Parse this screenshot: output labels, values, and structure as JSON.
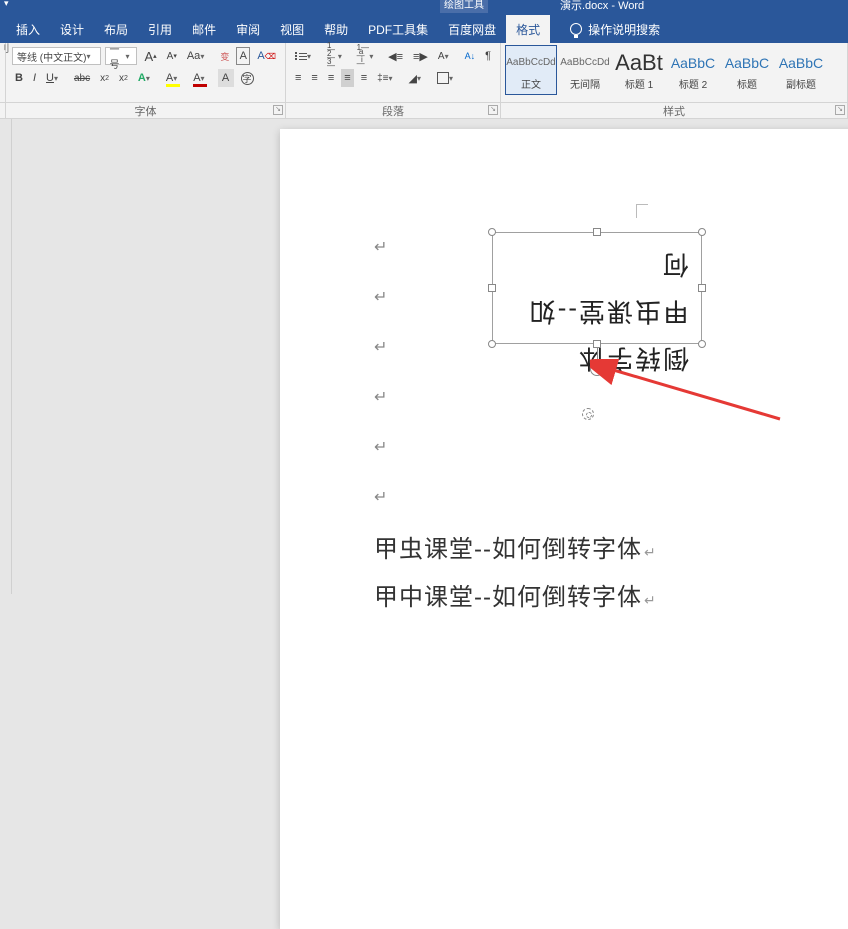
{
  "title": {
    "context": "绘图工具",
    "doc": "演示.docx  -  Word"
  },
  "tabs": [
    "插入",
    "设计",
    "布局",
    "引用",
    "邮件",
    "审阅",
    "视图",
    "帮助",
    "PDF工具集",
    "百度网盘",
    "格式"
  ],
  "active_tab": "格式",
  "tell_me": "操作说明搜索",
  "font": {
    "name": "等线 (中文正文)",
    "size": "一号",
    "grow": "A",
    "shrink": "A",
    "case": "Aa",
    "phon": "拼",
    "clear": "A",
    "bold": "B",
    "italic": "I",
    "underline": "U",
    "strike": "abc",
    "sub": "x₂",
    "sup": "x²",
    "highlight": "#ffff00",
    "fontcolor": "#c00000",
    "charshade": "A",
    "enclosed": "○"
  },
  "paragraph": {},
  "styles": {
    "items": [
      {
        "preview": "AaBbCcDd",
        "name": "正文",
        "cls": "small",
        "selected": true
      },
      {
        "preview": "AaBbCcDd",
        "name": "无间隔",
        "cls": "small"
      },
      {
        "preview": "AaBt",
        "name": "标题 1",
        "cls": "big"
      },
      {
        "preview": "AaBbC",
        "name": "标题 2",
        "cls": "blueh"
      },
      {
        "preview": "AaBbC",
        "name": "标题",
        "cls": "blueh"
      },
      {
        "preview": "AaBbC",
        "name": "副标题",
        "cls": "blueh"
      }
    ],
    "arrow": "⌄"
  },
  "group_labels": {
    "font": "字体",
    "para": "段落",
    "styles": "样式"
  },
  "textbox": {
    "line1": "倒转字体",
    "line2": "甲虫课堂--如何"
  },
  "body_lines": [
    "甲虫课堂--如何倒转字体",
    "甲中课堂--如何倒转字体"
  ],
  "para_mark": "↵"
}
